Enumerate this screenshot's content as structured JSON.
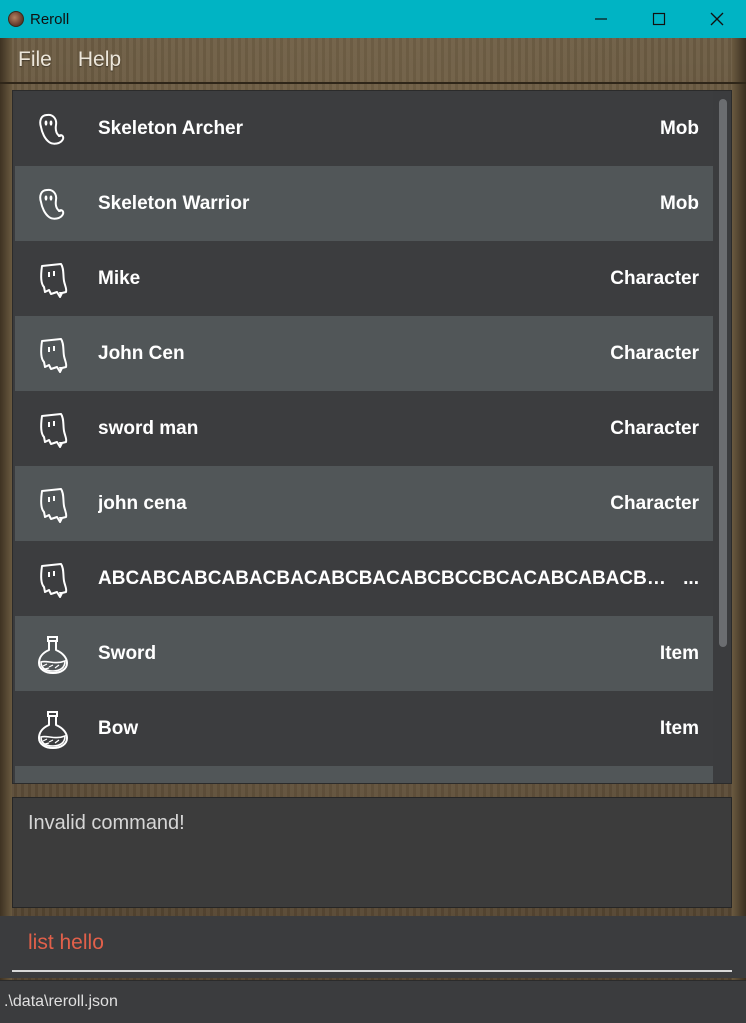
{
  "window": {
    "title": "Reroll",
    "app_icon": "reroll-app-icon",
    "titlebar_color": "#00b4c4"
  },
  "menu": {
    "items": [
      {
        "label": "File"
      },
      {
        "label": "Help"
      }
    ]
  },
  "entries": [
    {
      "name": "Skeleton Archer",
      "type": "Mob",
      "icon": "mob-ghost-icon"
    },
    {
      "name": "Skeleton Warrior",
      "type": "Mob",
      "icon": "mob-ghost-icon"
    },
    {
      "name": "Mike",
      "type": "Character",
      "icon": "character-ghost-icon"
    },
    {
      "name": "John Cen",
      "type": "Character",
      "icon": "character-ghost-icon"
    },
    {
      "name": "sword man",
      "type": "Character",
      "icon": "character-ghost-icon"
    },
    {
      "name": "john cena",
      "type": "Character",
      "icon": "character-ghost-icon"
    },
    {
      "name": "ABCABCABCABACBACABCBACABCBCCBCACABCABACBACBA...",
      "type": "...",
      "icon": "character-ghost-icon"
    },
    {
      "name": "Sword",
      "type": "Item",
      "icon": "potion-flask-icon"
    },
    {
      "name": "Bow",
      "type": "Item",
      "icon": "potion-flask-icon"
    }
  ],
  "result": {
    "text": "Invalid command!"
  },
  "command": {
    "value": "list hello",
    "text_color": "#e2604a"
  },
  "status": {
    "file_path": ".\\data\\reroll.json"
  }
}
